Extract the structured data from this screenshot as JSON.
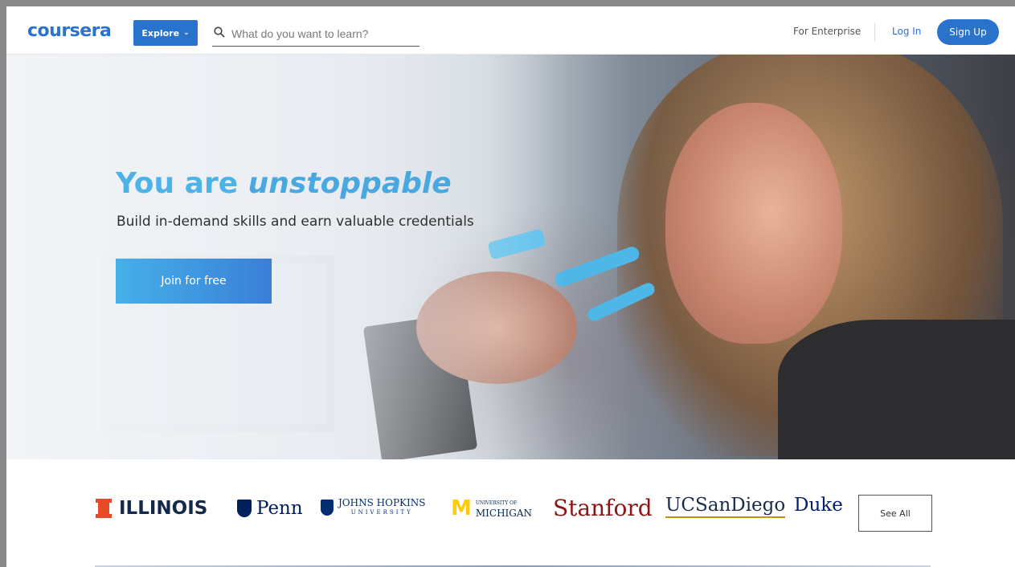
{
  "header": {
    "logo_text": "coursera",
    "explore_label": "Explore",
    "search_placeholder": "What do you want to learn?",
    "enterprise_label": "For Enterprise",
    "login_label": "Log In",
    "signup_label": "Sign Up",
    "brand_color": "#2a73cc"
  },
  "hero": {
    "title_prefix": "You are",
    "title_emphasis": "unstoppable",
    "subtitle": "Build in-demand skills and earn valuable credentials",
    "cta_label": "Join for free",
    "title_color": "#4db3e6"
  },
  "partners": {
    "items": [
      {
        "name": "ILLINOIS"
      },
      {
        "name": "Penn"
      },
      {
        "name": "JOHNS HOPKINS",
        "sub": "UNIVERSITY"
      },
      {
        "name": "MICHIGAN",
        "small": "UNIVERSITY OF"
      },
      {
        "name": "Stanford"
      },
      {
        "name": "UCSanDiego"
      },
      {
        "name": "Duke"
      }
    ],
    "see_all_label": "See All"
  },
  "icons": {
    "search": "search-icon",
    "explore_chevron": "chevron-down-icon"
  }
}
